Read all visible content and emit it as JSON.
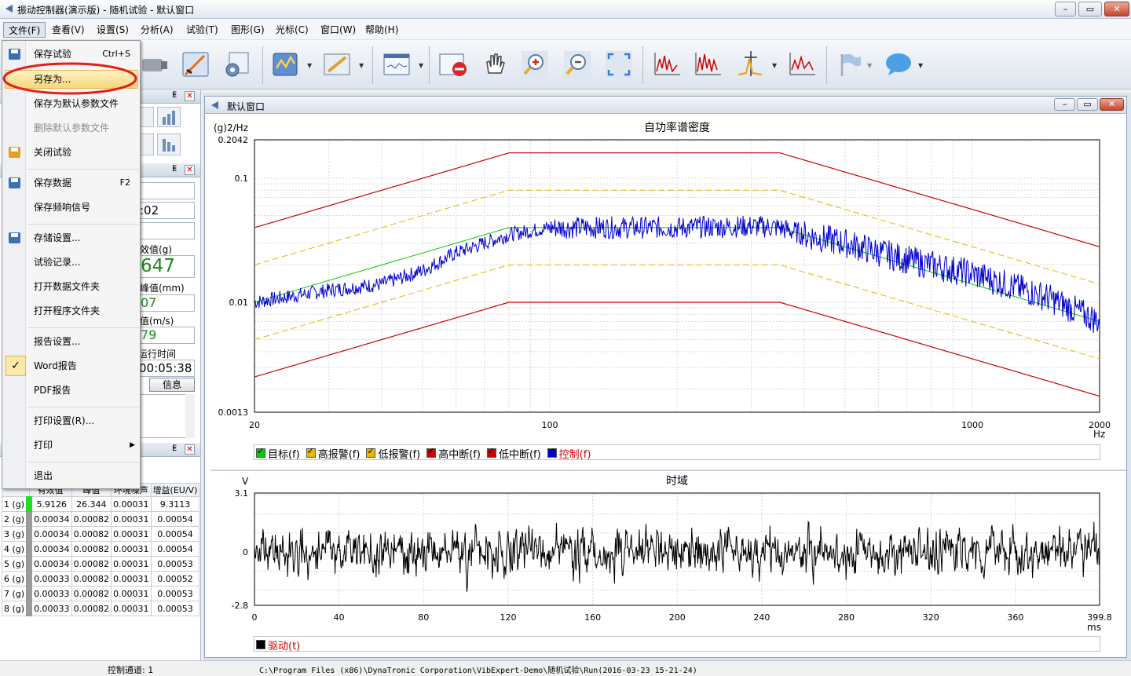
{
  "window": {
    "title": "振动控制器(演示版) - 随机试验 - 默认窗口",
    "min": "–",
    "max": "▭",
    "close": "✕"
  },
  "menubar": [
    "文件(F)",
    "查看(V)",
    "设置(S)",
    "分析(A)",
    "试验(T)",
    "图形(G)",
    "光标(C)",
    "窗口(W)",
    "帮助(H)"
  ],
  "file_menu": {
    "items": [
      {
        "label": "保存试验",
        "key": "Ctrl+S"
      },
      {
        "label": "另存为...",
        "key": ""
      },
      {
        "label": "保存为默认参数文件",
        "key": ""
      },
      {
        "label": "删除默认参数文件",
        "key": ""
      },
      {
        "label": "关闭试验",
        "key": ""
      },
      {
        "label": "保存数据",
        "key": "F2"
      },
      {
        "label": "保存频响信号",
        "key": ""
      },
      {
        "label": "存储设置...",
        "key": ""
      },
      {
        "label": "试验记录...",
        "key": ""
      },
      {
        "label": "打开数据文件夹",
        "key": ""
      },
      {
        "label": "打开程序文件夹",
        "key": ""
      },
      {
        "label": "报告设置...",
        "key": ""
      },
      {
        "label": "Word报告",
        "key": ""
      },
      {
        "label": "PDF报告",
        "key": ""
      },
      {
        "label": "打印设置(R)...",
        "key": ""
      },
      {
        "label": "打印",
        "key": "▶"
      },
      {
        "label": "退出",
        "key": ""
      }
    ],
    "highlighted": "另存为...",
    "checked": "Word报告",
    "disabled": "删除默认参数文件"
  },
  "left_panel": {
    "pin": "ᵖ",
    "close": "✕",
    "time_partial": ":02",
    "rms_label": "效值(g)",
    "rms_value": "647",
    "peak_label": "峰值(mm)",
    "peak_value": "07",
    "vel_label": "值(m/s)",
    "vel_value": "79",
    "run_label": "运行时间",
    "run_value": "00:05:38",
    "info_button": "信息"
  },
  "channel_table": {
    "headers": [
      "",
      "有效值",
      "峰值",
      "环境噪声",
      "增益(EU/V)"
    ],
    "rows": [
      [
        "1 (g)",
        "5.9126",
        "26.344",
        "0.00031",
        "9.3113"
      ],
      [
        "2 (g)",
        "0.00034",
        "0.00082",
        "0.00031",
        "0.00054"
      ],
      [
        "3 (g)",
        "0.00034",
        "0.00082",
        "0.00031",
        "0.00054"
      ],
      [
        "4 (g)",
        "0.00034",
        "0.00082",
        "0.00031",
        "0.00054"
      ],
      [
        "5 (g)",
        "0.00034",
        "0.00082",
        "0.00031",
        "0.00053"
      ],
      [
        "6 (g)",
        "0.00033",
        "0.00082",
        "0.00031",
        "0.00052"
      ],
      [
        "7 (g)",
        "0.00033",
        "0.00082",
        "0.00031",
        "0.00053"
      ],
      [
        "8 (g)",
        "0.00033",
        "0.00082",
        "0.00031",
        "0.00053"
      ]
    ]
  },
  "child_window": {
    "title": "默认窗口"
  },
  "psd": {
    "title": "自功率谱密度",
    "ylabel": "(g)2/Hz",
    "xunit": "Hz",
    "yticks": [
      "0.2042",
      "0.1",
      "0.01",
      "0.0013"
    ],
    "xticks": [
      "20",
      "100",
      "1000",
      "2000"
    ],
    "legend": [
      {
        "name": "目标(f)",
        "color": "#00cc00"
      },
      {
        "name": "高报警(f)",
        "color": "#e6b800"
      },
      {
        "name": "低报警(f)",
        "color": "#e6b800"
      },
      {
        "name": "高中断(f)",
        "color": "#cc0000"
      },
      {
        "name": "低中断(f)",
        "color": "#cc0000"
      },
      {
        "name": "控制(f)",
        "color": "#0000cc"
      }
    ]
  },
  "chart_data": [
    {
      "type": "line",
      "title": "自功率谱密度",
      "ylabel": "(g)2/Hz",
      "xlabel": "Hz",
      "xscale": "log",
      "yscale": "log",
      "xlim": [
        20,
        2000
      ],
      "ylim": [
        0.0013,
        0.2042
      ],
      "series": [
        {
          "name": "目标(f)",
          "x": [
            20,
            80,
            350,
            2000
          ],
          "y": [
            0.01,
            0.04,
            0.04,
            0.007
          ]
        },
        {
          "name": "高报警(f)",
          "x": [
            20,
            80,
            350,
            2000
          ],
          "y": [
            0.02,
            0.08,
            0.08,
            0.014
          ]
        },
        {
          "name": "低报警(f)",
          "x": [
            20,
            80,
            350,
            2000
          ],
          "y": [
            0.005,
            0.02,
            0.02,
            0.0035
          ]
        },
        {
          "name": "高中断(f)",
          "x": [
            20,
            80,
            350,
            2000
          ],
          "y": [
            0.04,
            0.16,
            0.16,
            0.028
          ]
        },
        {
          "name": "低中断(f)",
          "x": [
            20,
            80,
            350,
            2000
          ],
          "y": [
            0.0025,
            0.01,
            0.01,
            0.00175
          ]
        },
        {
          "name": "控制(f)",
          "x": [
            20,
            30,
            40,
            50,
            60,
            80,
            100,
            150,
            200,
            300,
            350,
            400,
            500,
            700,
            1000,
            1500,
            2000
          ],
          "y": [
            0.01,
            0.0125,
            0.014,
            0.018,
            0.025,
            0.035,
            0.04,
            0.04,
            0.04,
            0.041,
            0.04,
            0.035,
            0.03,
            0.022,
            0.017,
            0.011,
            0.007
          ]
        }
      ]
    },
    {
      "type": "line",
      "title": "时域",
      "ylabel": "V",
      "xlabel": "ms",
      "xlim": [
        0,
        399.8
      ],
      "ylim": [
        -2.8,
        3.1
      ],
      "xticks": [
        "0",
        "40",
        "80",
        "120",
        "160",
        "200",
        "240",
        "280",
        "320",
        "360",
        "399.8"
      ],
      "yticks": [
        "3.1",
        "0",
        "-2.8"
      ],
      "series": [
        {
          "name": "驱动(t)",
          "note": "random noise around 0"
        }
      ]
    }
  ],
  "time": {
    "title": "时域",
    "ylabel": "V",
    "xunit": "ms",
    "legend": "驱动(t)",
    "yticks": [
      "3.1",
      "0",
      "-2.8"
    ],
    "xticks": [
      "0",
      "40",
      "80",
      "120",
      "160",
      "200",
      "240",
      "280",
      "320",
      "360",
      "399.8"
    ]
  },
  "status": {
    "channel": "控制通道: 1",
    "path": "C:\\Program Files (x86)\\DynaTronic Corporation\\VibExpert-Demo\\随机试验\\Run(2016-03-23 15-21-24)"
  }
}
